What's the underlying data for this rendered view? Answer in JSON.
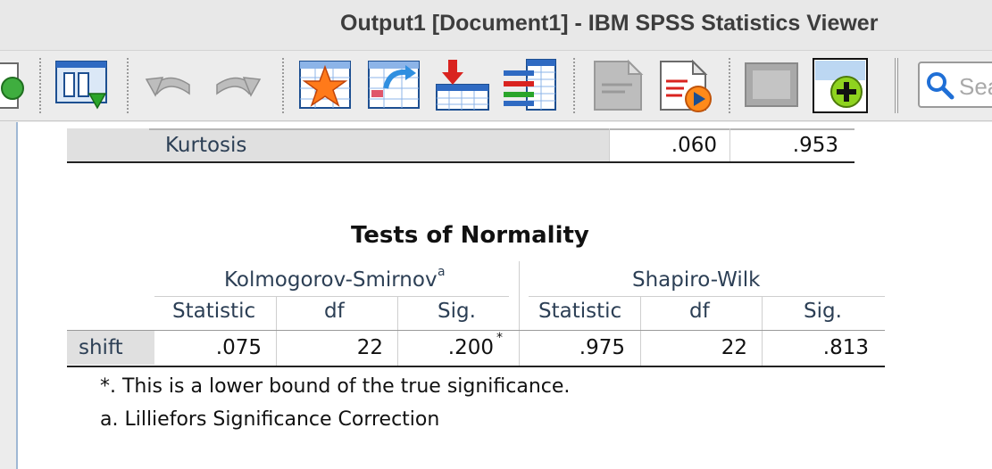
{
  "window": {
    "title": "Output1 [Document1] - IBM SPSS Statistics Viewer"
  },
  "toolbar": {
    "search_placeholder": "Search",
    "icons": [
      "export-icon",
      "designate-window-icon",
      "undo-icon",
      "redo-icon",
      "goto-data-icon",
      "goto-case-icon",
      "insert-case-icon",
      "variables-icon",
      "create-edit-autoscript-icon",
      "run-script-icon",
      "insert-heading-icon",
      "insert-title-icon",
      "search-icon"
    ]
  },
  "descriptives_fragment": {
    "row_label": "Kurtosis",
    "statistic": ".060",
    "std_error": ".953"
  },
  "normality_table": {
    "title": "Tests of Normality",
    "group1": {
      "name": "Kolmogorov-Smirnov",
      "superscript": "a"
    },
    "group2": {
      "name": "Shapiro-Wilk"
    },
    "columns": [
      "Statistic",
      "df",
      "Sig.",
      "Statistic",
      "df",
      "Sig."
    ],
    "row": {
      "label": "shift",
      "ks_statistic": ".075",
      "ks_df": "22",
      "ks_sig": ".200",
      "ks_sig_mark": "*",
      "sw_statistic": ".975",
      "sw_df": "22",
      "sw_sig": ".813"
    },
    "footnotes": [
      "*. This is a lower bound of the true significance.",
      "a. Lilliefors Significance Correction"
    ]
  }
}
